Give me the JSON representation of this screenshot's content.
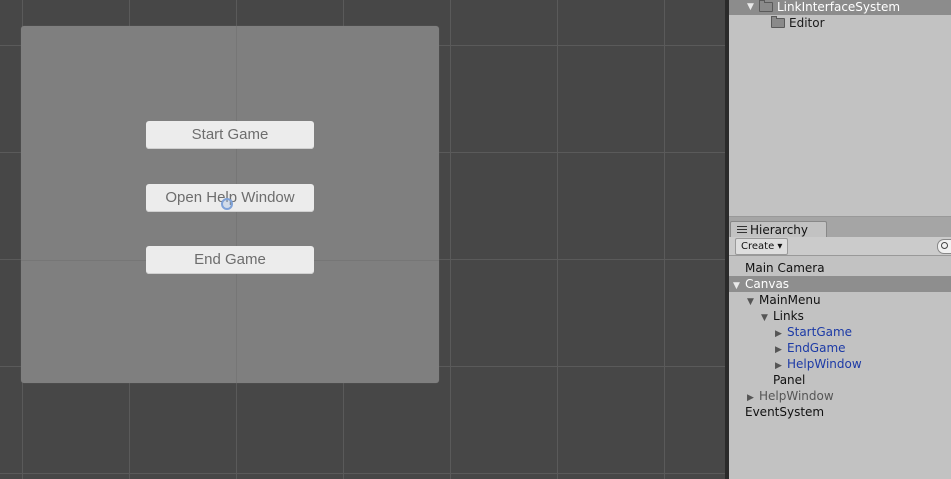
{
  "scene": {
    "buttons": {
      "start": "Start Game",
      "help": "Open Help Window",
      "end": "End Game"
    }
  },
  "project": {
    "items": [
      {
        "label": "LinkInterfaceSystem",
        "selected": true
      },
      {
        "label": "Editor",
        "selected": false
      }
    ]
  },
  "hierarchy": {
    "tab_label": "Hierarchy",
    "create_label": "Create ▾",
    "items": [
      {
        "label": "Main Camera"
      },
      {
        "label": "Canvas"
      },
      {
        "label": "MainMenu"
      },
      {
        "label": "Links"
      },
      {
        "label": "StartGame"
      },
      {
        "label": "EndGame"
      },
      {
        "label": "HelpWindow"
      },
      {
        "label": "Panel"
      },
      {
        "label": "HelpWindow"
      },
      {
        "label": "EventSystem"
      }
    ]
  },
  "icons": {
    "expanded": "▼",
    "collapsed": "▶"
  },
  "colors": {
    "prefab_text": "#1c3aa6",
    "selection": "#8e8e8e",
    "scene_bg": "#474747",
    "panel_bg": "#7f7f7f"
  }
}
